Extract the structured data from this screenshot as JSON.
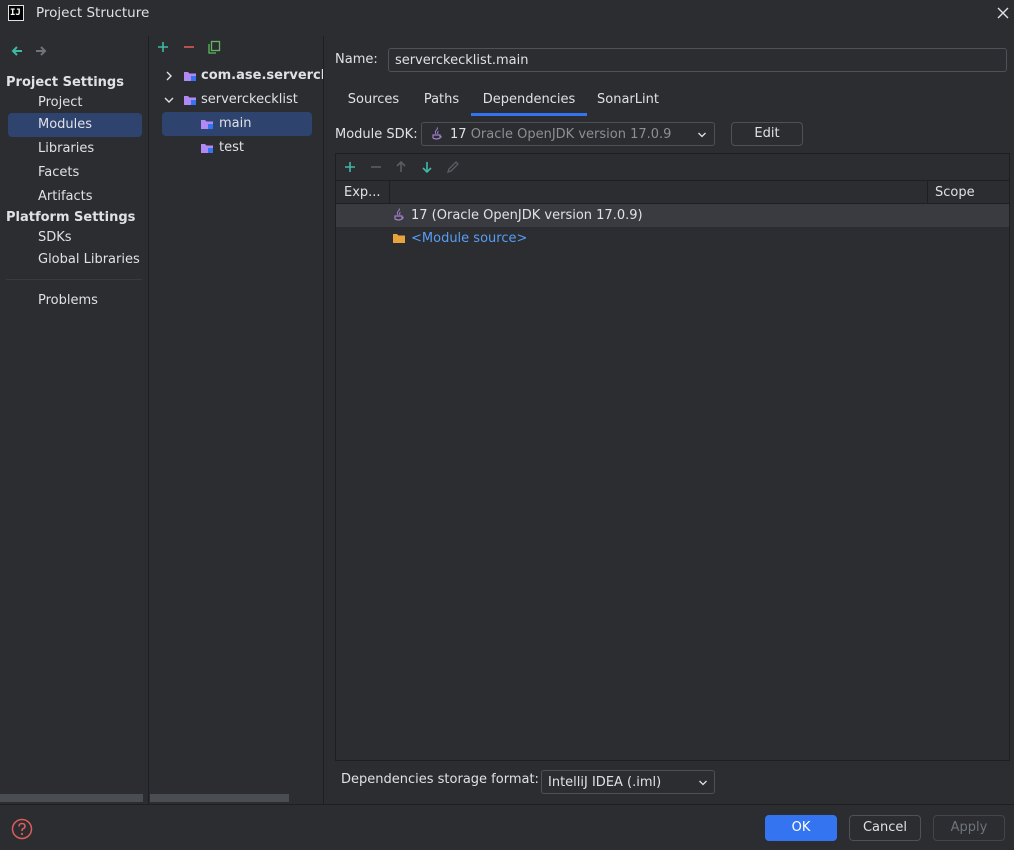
{
  "window": {
    "title": "Project Structure",
    "logo_text": "IJ"
  },
  "nav": {
    "project_settings_header": "Project Settings",
    "project_items": [
      "Project",
      "Modules",
      "Libraries",
      "Facets",
      "Artifacts"
    ],
    "selected": "Modules",
    "platform_settings_header": "Platform Settings",
    "platform_items": [
      "SDKs",
      "Global Libraries"
    ],
    "problems": "Problems"
  },
  "tree": {
    "nodes": [
      {
        "label": "com.ase.serverckec",
        "level": 0,
        "expanded": false
      },
      {
        "label": "serverckecklist",
        "level": 0,
        "expanded": true
      },
      {
        "label": "main",
        "level": 1,
        "selected": true
      },
      {
        "label": "test",
        "level": 1
      }
    ]
  },
  "module": {
    "name_label": "Name:",
    "name_value": "serverckecklist.main",
    "tabs": [
      "Sources",
      "Paths",
      "Dependencies",
      "SonarLint"
    ],
    "active_tab": "Dependencies",
    "sdk_label": "Module SDK:",
    "sdk_value_num": "17",
    "sdk_value_text": "Oracle OpenJDK version 17.0.9",
    "edit_label": "Edit"
  },
  "dependencies": {
    "columns": {
      "export": "Exp...",
      "scope": "Scope"
    },
    "rows": [
      {
        "label": "17 (Oracle OpenJDK version 17.0.9)",
        "icon": "java-cup-icon",
        "selected": true
      },
      {
        "label": "<Module source>",
        "icon": "folder-icon",
        "link": true
      }
    ]
  },
  "storage": {
    "label": "Dependencies storage format:",
    "value": "IntelliJ IDEA (.iml)"
  },
  "footer": {
    "ok": "OK",
    "cancel": "Cancel",
    "apply": "Apply"
  },
  "colors": {
    "accent": "#3574f0",
    "selection": "#2e436e",
    "link": "#589df6",
    "remove_red": "#db5c5c",
    "add_green": "#3fb9a5"
  }
}
